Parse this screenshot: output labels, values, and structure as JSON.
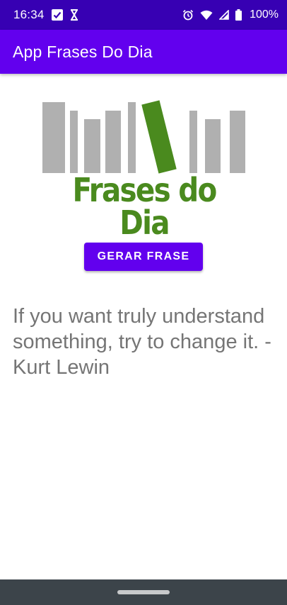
{
  "status_bar": {
    "time": "16:34",
    "battery": "100%",
    "icons_left": [
      "check-box-icon",
      "hourglass-icon"
    ],
    "icons_right": [
      "alarm-icon",
      "wifi-icon",
      "signal-icon",
      "battery-icon"
    ],
    "background": "#3700b3"
  },
  "app_bar": {
    "title": "App Frases Do Dia",
    "background": "#6200ee"
  },
  "logo": {
    "text": "Frases do Dia",
    "text_color": "#4a8a1e",
    "book_color": "#b0b0b0"
  },
  "button": {
    "label": "GERAR FRASE",
    "color": "#6200ee"
  },
  "quote": {
    "text": "If you want truly understand something, try to change it. - Kurt Lewin",
    "color": "#757575"
  },
  "nav_bar": {
    "background": "#3c444a"
  }
}
